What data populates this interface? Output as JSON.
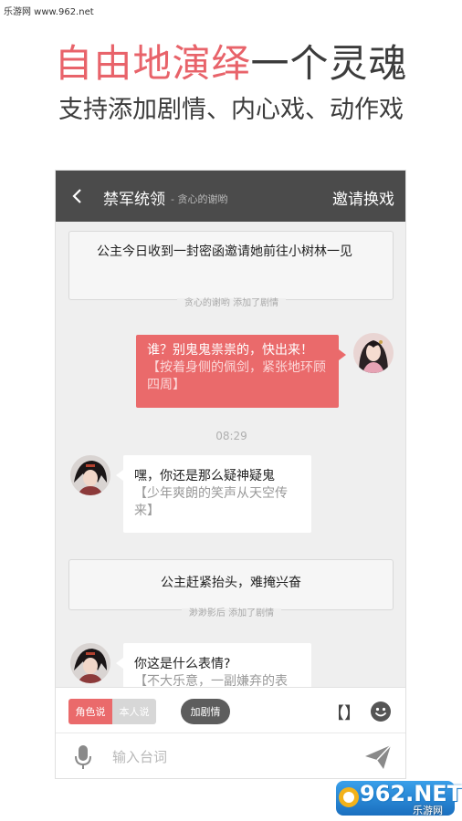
{
  "watermark": "乐游网 www.962.net",
  "promo": {
    "title_highlight": "自由地演绎",
    "title_rest": "一个灵魂",
    "subtitle": "支持添加剧情、内心戏、动作戏"
  },
  "header": {
    "title": "禁军统领",
    "author": "- 贪心的谢哟",
    "invite_label": "邀请换戏"
  },
  "chat": {
    "plot1": {
      "text": "公主今日收到一封密函邀请她前往小树林一见",
      "note": "贪心的谢哟 添加了剧情"
    },
    "msg_right": {
      "speech": "谁？别鬼鬼祟祟的，快出来！",
      "action": "【按着身侧的佩剑，紧张地环顾四周】"
    },
    "timestamp": "08:29",
    "msg_left1": {
      "speech": "嘿，你还是那么疑神疑鬼",
      "action": "【少年爽朗的笑声从天空传来】"
    },
    "plot2": {
      "text": "公主赶紧抬头，难掩兴奋",
      "note": "渺渺影后 添加了剧情"
    },
    "msg_left2": {
      "speech": "你这是什么表情?",
      "action": "【不大乐意，一副嫌弃的表"
    }
  },
  "toolbar": {
    "role_on": "角色说",
    "role_off": "本人说",
    "add_plot": "加剧情",
    "bracket": "【】"
  },
  "input": {
    "placeholder": "输入台词"
  },
  "brand": {
    "domain": "962.NET",
    "name": "乐游网"
  },
  "colors": {
    "accent": "#ea6a6b",
    "header_bg": "#4b4b4b",
    "chat_bg": "#efefef"
  }
}
